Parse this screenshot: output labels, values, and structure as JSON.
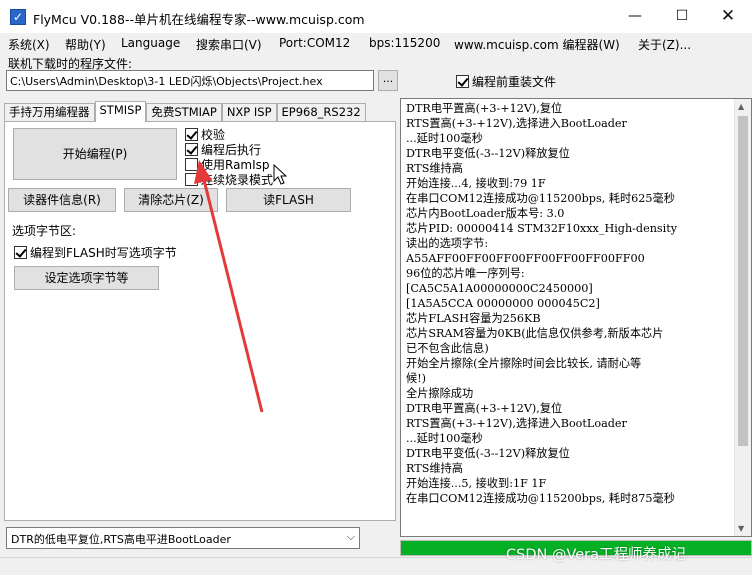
{
  "window": {
    "title": "FlyMcu V0.188--单片机在线编程专家--www.mcuisp.com",
    "icon_glyph": "✓",
    "controls": {
      "minimize": "—",
      "maximize": "☐",
      "close": "✕"
    }
  },
  "menu": [
    "系统(X)",
    "帮助(Y)",
    "Language",
    "搜索串口(V)",
    "Port:COM12",
    "bps:115200",
    "www.mcuisp.com 编程器(W)",
    "关于(Z)..."
  ],
  "file": {
    "label": "联机下载时的程序文件:",
    "path": "C:\\Users\\Admin\\Desktop\\3-1 LED闪烁\\Objects\\Project.hex",
    "browse_label": "...",
    "reload_label": "编程前重装文件",
    "reload_checked": true
  },
  "tabs": [
    "手持万用编程器",
    "STMISP",
    "免费STMIAP",
    "NXP ISP",
    "EP968_RS232"
  ],
  "active_tab": "STMISP",
  "stmisp": {
    "start_label": "开始编程(P)",
    "options": [
      {
        "label": "校验",
        "checked": true
      },
      {
        "label": "编程后执行",
        "checked": true
      },
      {
        "label": "使用RamIsp",
        "checked": false
      },
      {
        "label": "连续烧录模式",
        "checked": false
      }
    ],
    "read_info_label": "读器件信息(R)",
    "erase_label": "清除芯片(Z)",
    "read_flash_label": "读FLASH",
    "option_group_label": "选项字节区:",
    "flash_option_label": "编程到FLASH时写选项字节",
    "flash_option_checked": true,
    "set_option_label": "设定选项字节等"
  },
  "mode_select": {
    "value": "DTR的低电平复位,RTS高电平进BootLoader",
    "arrow": "⌵"
  },
  "log": [
    "DTR电平置高(+3-+12V),复位",
    "RTS置高(+3-+12V),选择进入BootLoader",
    "...延时100毫秒",
    "DTR电平变低(-3--12V)释放复位",
    "RTS维持高",
    "开始连接...4, 接收到:79 1F",
    "在串口COM12连接成功@115200bps, 耗时625毫秒",
    "芯片内BootLoader版本号: 3.0",
    "芯片PID: 00000414  STM32F10xxx_High-density",
    "读出的选项字节:",
    "A55AFF00FF00FF00FF00FF00FF00FF00",
    "96位的芯片唯一序列号:",
    "[CA5C5A1A00000000C2450000]",
    "[1A5A5CCA 00000000 000045C2]",
    "芯片FLASH容量为256KB",
    "芯片SRAM容量为0KB(此信息仅供参考,新版本芯片",
    "已不包含此信息)",
    "开始全片擦除(全片擦除时间会比较长, 请耐心等",
    "候!)",
    "全片擦除成功",
    "DTR电平置高(+3-+12V),复位",
    "RTS置高(+3-+12V),选择进入BootLoader",
    "...延时100毫秒",
    "DTR电平变低(-3--12V)释放复位",
    "RTS维持高",
    "开始连接...5, 接收到:1F 1F",
    "在串口COM12连接成功@115200bps, 耗时875毫秒"
  ],
  "progress": {
    "fraction": 1.0,
    "color": "#06b025"
  },
  "watermark": "CSDN @Vera工程师养成记",
  "colors": {
    "annotation_arrow": "#e53a3a"
  }
}
